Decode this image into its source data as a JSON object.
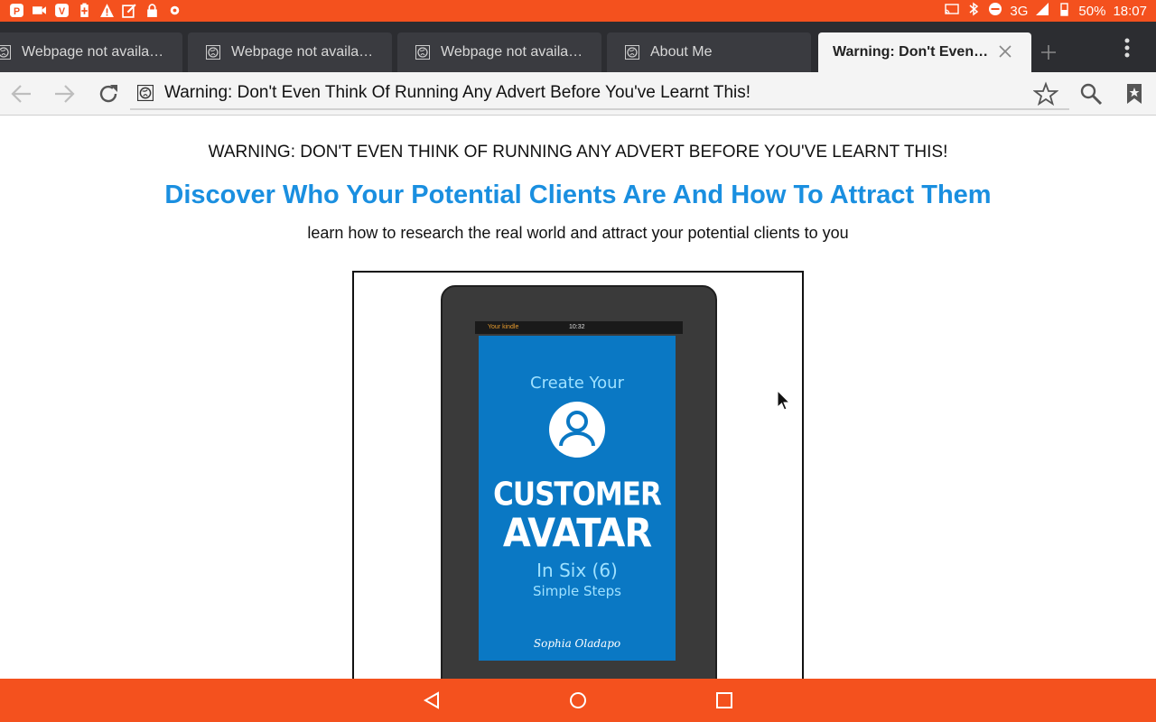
{
  "status_bar": {
    "left_icons": [
      "p-app-icon",
      "video-icon",
      "v-app-icon",
      "battery-saver-icon",
      "warning-icon",
      "edit-icon",
      "lock-icon",
      "game-icon"
    ],
    "network": "3G",
    "battery": "50%",
    "time": "18:07"
  },
  "tabs": [
    {
      "label": "Webpage not availa…",
      "active": false
    },
    {
      "label": "Webpage not availa…",
      "active": false
    },
    {
      "label": "Webpage not availa…",
      "active": false
    },
    {
      "label": "About Me",
      "active": false
    },
    {
      "label": "Warning: Don't Even…",
      "active": true
    }
  ],
  "toolbar": {
    "url_text": "Warning: Don't Even Think Of Running Any Advert Before You've Learnt This!"
  },
  "page": {
    "warning": "WARNING: DON'T EVEN THINK OF RUNNING ANY ADVERT BEFORE YOU'VE LEARNT THIS!",
    "headline": "Discover Who Your Potential Clients Are And How To Attract Them",
    "subheadline": "learn how to research the real world and attract your potential clients to you",
    "book": {
      "device_brand": "Your kindle",
      "device_time": "10:32",
      "title_line1": "Create Your",
      "title_line2": "CUSTOMER",
      "title_line3": "AVATAR",
      "title_line4": "In Six (6)",
      "title_line5": "Simple Steps",
      "author": "Sophia Oladapo"
    }
  },
  "colors": {
    "status_bar": "#f4511e",
    "headline": "#1a8fe0",
    "cover": "#0a78c4"
  }
}
